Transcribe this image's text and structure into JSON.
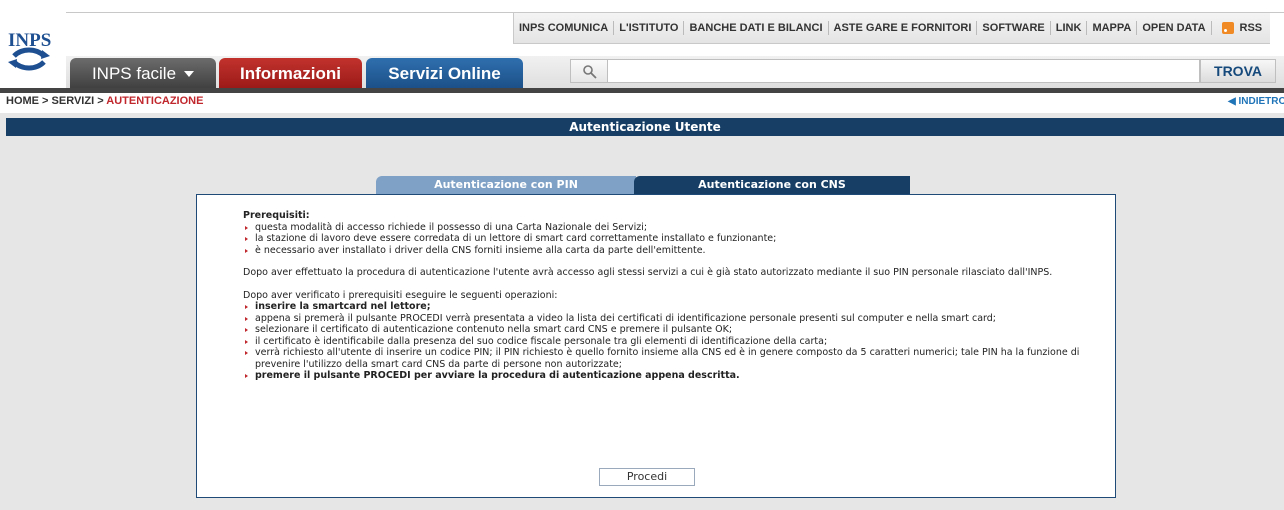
{
  "logo": {
    "text": "INPS"
  },
  "top_links": [
    "INPS COMUNICA",
    "L'ISTITUTO",
    "BANCHE DATI E BILANCI",
    "ASTE GARE E FORNITORI",
    "SOFTWARE",
    "LINK",
    "MAPPA",
    "OPEN DATA"
  ],
  "rss_label": "RSS",
  "nav": {
    "facile": "INPS facile",
    "info": "Informazioni",
    "servizi": "Servizi Online"
  },
  "search": {
    "placeholder": "",
    "button": "TROVA"
  },
  "breadcrumb": {
    "home": "HOME",
    "sep": " > ",
    "servizi": "SERVIZI",
    "current": "AUTENTICAZIONE"
  },
  "indietro": "◀ INDIETRO",
  "title": "Autenticazione Utente",
  "tabs": {
    "pin": "Autenticazione con PIN",
    "cns": "Autenticazione con CNS"
  },
  "content": {
    "prereq_title": "Prerequisiti:",
    "prereq": [
      "questa modalità di accesso richiede il possesso di una Carta Nazionale dei Servizi;",
      "la stazione di lavoro deve essere corredata di un lettore di smart card correttamente installato e funzionante;",
      "è necessario aver installato i driver della CNS forniti insieme alla carta da parte dell'emittente."
    ],
    "para1": "Dopo aver effettuato la procedura di autenticazione l'utente avrà accesso agli stessi servizi a cui è già stato autorizzato mediante il suo PIN personale rilasciato dall'INPS.",
    "para2": "Dopo aver verificato i prerequisiti eseguire le seguenti operazioni:",
    "steps": [
      "inserire la smartcard nel lettore;",
      "appena si premerà il pulsante PROCEDI verrà presentata a video la lista dei certificati di identificazione personale presenti sul computer e nella smart card;",
      "selezionare il certificato di autenticazione contenuto nella smart card CNS e premere il pulsante OK;",
      "il certificato è identificabile dalla presenza del suo codice fiscale personale tra gli elementi di identificazione della carta;",
      "verrà richiesto all'utente di inserire un codice PIN; il PIN richiesto è quello fornito insieme alla CNS ed è in genere composto da 5 caratteri numerici; tale PIN ha la funzione di prevenire l'utilizzo della smart card CNS da parte di persone non autorizzate;",
      "premere il pulsante PROCEDI per avviare la procedura di autenticazione appena descritta."
    ]
  },
  "procedi_button": "Procedi",
  "colors": {
    "header_blue": "#173f66",
    "tab_light": "#7fa1c5",
    "red": "#c0272d",
    "link_blue": "#1f74b8"
  }
}
